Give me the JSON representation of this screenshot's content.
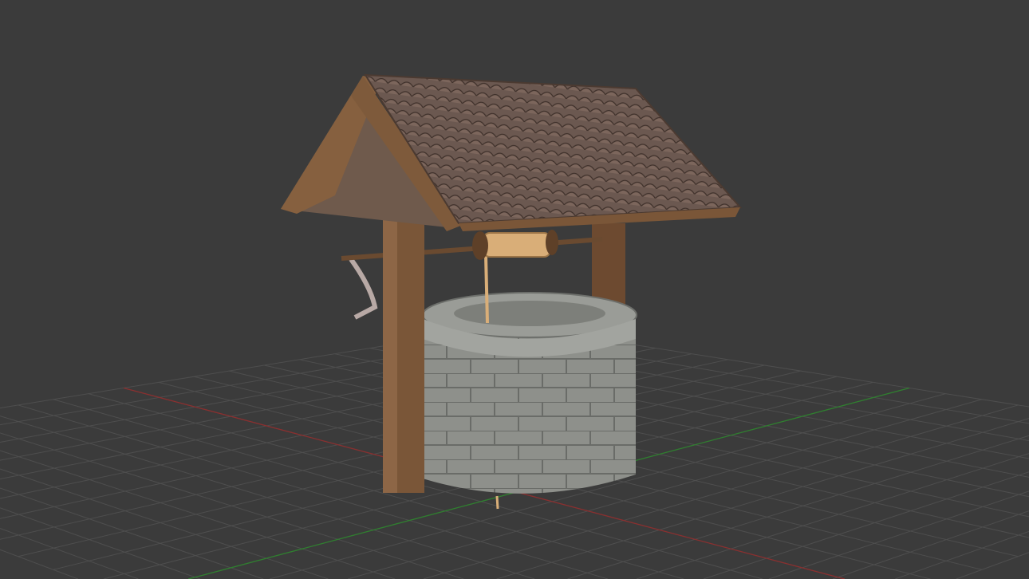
{
  "viewport": {
    "background": "#3b3b3b",
    "grid_color": "#4e4e4e",
    "axis_x_color": "#8a2f2f",
    "axis_y_color": "#2f7f2f",
    "grid_divisions": 22
  },
  "model": {
    "roof_color": "#6e5a50",
    "wood_color": "#7a5638",
    "stone_color": "#8f918c",
    "rope_color": "#d9ae78"
  }
}
